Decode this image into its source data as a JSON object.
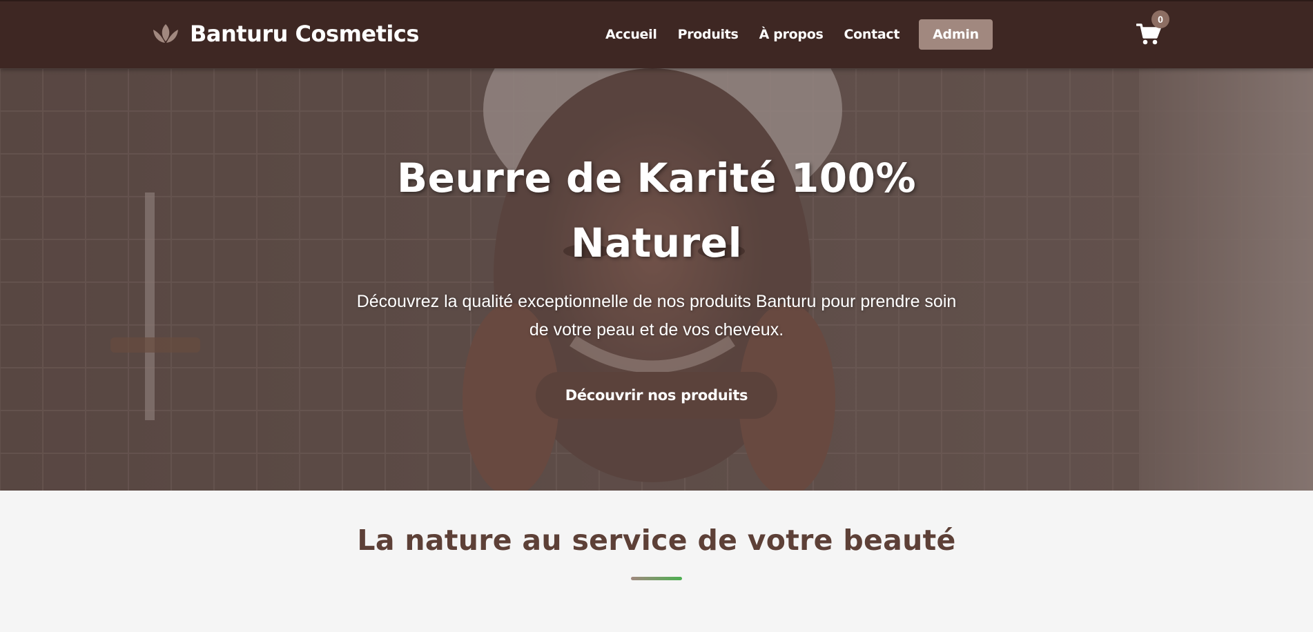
{
  "header": {
    "brand_name": "Banturu Cosmetics",
    "logo_icon": "lotus-icon",
    "nav": [
      {
        "label": "Accueil"
      },
      {
        "label": "Produits"
      },
      {
        "label": "À propos"
      },
      {
        "label": "Contact"
      }
    ],
    "admin_label": "Admin",
    "cart_icon": "cart-icon",
    "cart_count": "0"
  },
  "hero": {
    "title": "Beurre de Karité 100% Naturel",
    "subtitle": "Découvrez la qualité exceptionnelle de nos produits Banturu pour prendre soin de votre peau et de vos cheveux.",
    "cta_label": "Découvrir nos produits"
  },
  "intro": {
    "title": "La nature au service de votre beauté"
  },
  "colors": {
    "header_bg": "#3e2723",
    "accent": "#a1887f",
    "cta_bg": "#5b423b",
    "heading": "#5d4037",
    "underline_end": "#4caf50"
  }
}
